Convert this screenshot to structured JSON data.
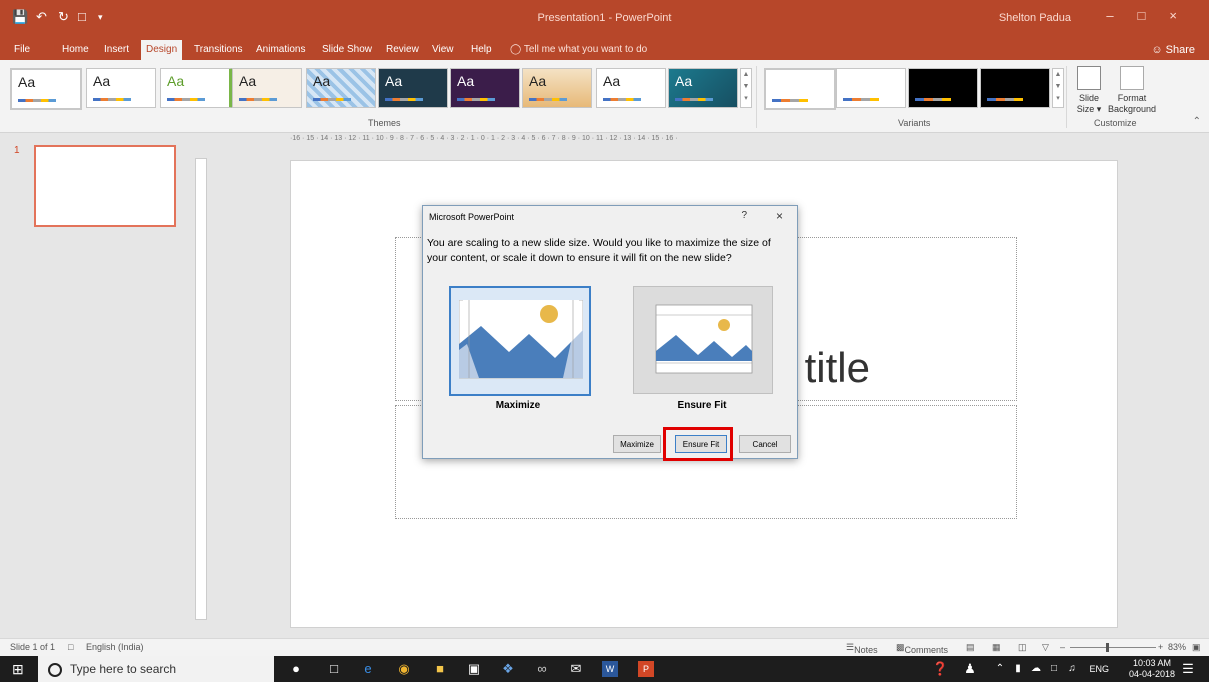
{
  "window": {
    "title": "Presentation1 - PowerPoint",
    "user": "Shelton Padua"
  },
  "ribbon_tabs": [
    "File",
    "Home",
    "Insert",
    "Design",
    "Transitions",
    "Animations",
    "Slide Show",
    "Review",
    "View",
    "Help"
  ],
  "active_tab": "Design",
  "tell_me": "Tell me what you want to do",
  "share_label": "Share",
  "themes_group": {
    "label": "Themes",
    "thumb_label": "Aa"
  },
  "variants_group": {
    "label": "Variants"
  },
  "customize_group": {
    "label": "Customize",
    "slide_size": "Slide Size",
    "format_background": "Format Background"
  },
  "ruler": {
    "horizontal": "·16 · 15 · 14 · 13 · 12 · 11 · 10 · 9 · 8 · 7 · 6 · 5 · 4 · 3 · 2 · 1 · 0 · 1 · 2 · 3 · 4 · 5 · 6 · 7 · 8 · 9 · 10 · 11 · 12 · 13 · 14 · 15 · 16 ·"
  },
  "slides_pane": {
    "slide_number": "1"
  },
  "slide": {
    "title_placeholder_visible": "title"
  },
  "dialog": {
    "title": "Microsoft PowerPoint",
    "help": "?",
    "close": "×",
    "message": "You are scaling to a new slide size.  Would you like to maximize the size of your content, or scale it down to ensure it will fit on the new slide?",
    "option_maximize": "Maximize",
    "option_ensure_fit": "Ensure Fit",
    "btn_maximize": "Maximize",
    "btn_ensure_fit": "Ensure Fit",
    "btn_cancel": "Cancel"
  },
  "statusbar": {
    "slide_info": "Slide 1 of 1",
    "language": "English (India)",
    "notes": "Notes",
    "comments": "Comments",
    "zoom": "83%"
  },
  "taskbar": {
    "search_placeholder": "Type here to search",
    "language": "ENG",
    "time": "10:03 AM",
    "date": "04-04-2018"
  },
  "colors": {
    "accent": "#b7472a",
    "dialog_highlight": "#e00000",
    "selected_option_border": "#3c7fc7"
  }
}
